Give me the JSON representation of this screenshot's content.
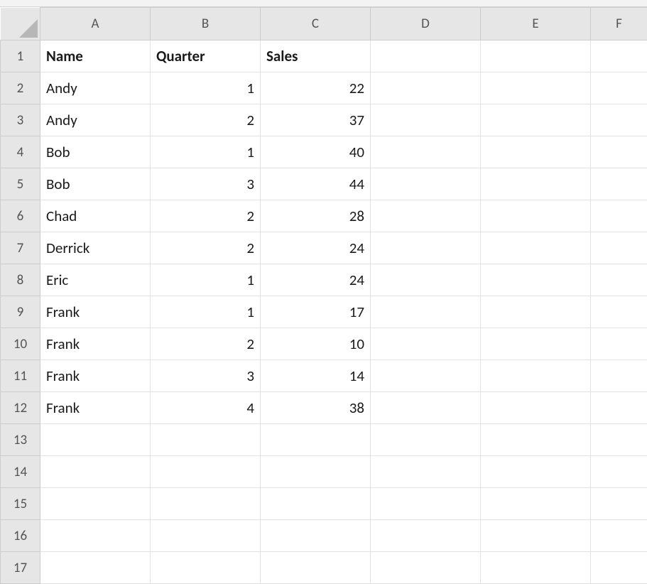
{
  "columns": [
    "A",
    "B",
    "C",
    "D",
    "E",
    "F"
  ],
  "row_count": 17,
  "headers": {
    "A": "Name",
    "B": "Quarter",
    "C": "Sales"
  },
  "rows": [
    {
      "name": "Andy",
      "quarter": 1,
      "sales": 22
    },
    {
      "name": "Andy",
      "quarter": 2,
      "sales": 37
    },
    {
      "name": "Bob",
      "quarter": 1,
      "sales": 40
    },
    {
      "name": "Bob",
      "quarter": 3,
      "sales": 44
    },
    {
      "name": "Chad",
      "quarter": 2,
      "sales": 28
    },
    {
      "name": "Derrick",
      "quarter": 2,
      "sales": 24
    },
    {
      "name": "Eric",
      "quarter": 1,
      "sales": 24
    },
    {
      "name": "Frank",
      "quarter": 1,
      "sales": 17
    },
    {
      "name": "Frank",
      "quarter": 2,
      "sales": 10
    },
    {
      "name": "Frank",
      "quarter": 3,
      "sales": 14
    },
    {
      "name": "Frank",
      "quarter": 4,
      "sales": 38
    }
  ],
  "chart_data": {
    "type": "table",
    "title": "",
    "columns": [
      "Name",
      "Quarter",
      "Sales"
    ],
    "data": [
      [
        "Andy",
        1,
        22
      ],
      [
        "Andy",
        2,
        37
      ],
      [
        "Bob",
        1,
        40
      ],
      [
        "Bob",
        3,
        44
      ],
      [
        "Chad",
        2,
        28
      ],
      [
        "Derrick",
        2,
        24
      ],
      [
        "Eric",
        1,
        24
      ],
      [
        "Frank",
        1,
        17
      ],
      [
        "Frank",
        2,
        10
      ],
      [
        "Frank",
        3,
        14
      ],
      [
        "Frank",
        4,
        38
      ]
    ]
  }
}
